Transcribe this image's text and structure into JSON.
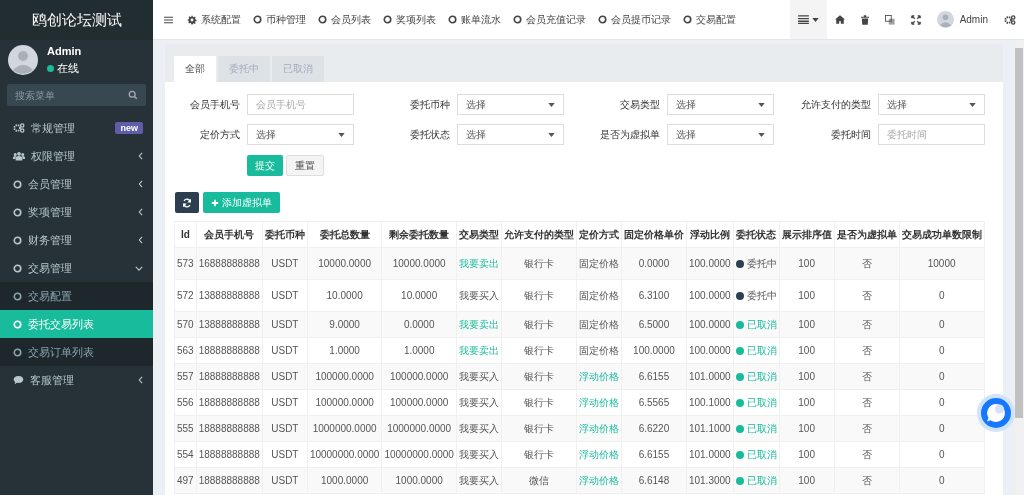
{
  "sidebar": {
    "title": "鸥创论坛测试",
    "user": {
      "name": "Admin",
      "status": "在线",
      "online": true
    },
    "search": {
      "placeholder": "搜索菜单"
    },
    "items": [
      {
        "label": "常规管理",
        "badge": "new"
      },
      {
        "label": "权限管理",
        "expanded": false
      },
      {
        "label": "会员管理",
        "expanded": false
      },
      {
        "label": "奖项管理",
        "expanded": false
      },
      {
        "label": "财务管理",
        "expanded": false
      },
      {
        "label": "交易管理",
        "expanded": true,
        "children": [
          {
            "label": "交易配置",
            "selected": false
          },
          {
            "label": "委托交易列表",
            "selected": true
          },
          {
            "label": "交易订单列表",
            "selected": false
          }
        ]
      },
      {
        "label": "客服管理",
        "expanded": false
      }
    ]
  },
  "topbar": {
    "tabs": [
      "系统配置",
      "币种管理",
      "会员列表",
      "奖项列表",
      "账单流水",
      "会员充值记录",
      "会员提币记录",
      "交易配置"
    ],
    "user": "Admin"
  },
  "tabs": [
    {
      "label": "全部",
      "selected": true
    },
    {
      "label": "委托中",
      "selected": false
    },
    {
      "label": "已取消",
      "selected": false
    }
  ],
  "filters": [
    {
      "label": "会员手机号",
      "kind": "input",
      "placeholder": "会员手机号"
    },
    {
      "label": "委托币种",
      "kind": "select",
      "value": "选择"
    },
    {
      "label": "交易类型",
      "kind": "select",
      "value": "选择"
    },
    {
      "label": "允许支付的类型",
      "kind": "select",
      "value": "选择"
    },
    {
      "label": "定价方式",
      "kind": "select",
      "value": "选择"
    },
    {
      "label": "委托状态",
      "kind": "select",
      "value": "选择"
    },
    {
      "label": "是否为虚拟单",
      "kind": "select",
      "value": "选择"
    },
    {
      "label": "委托时间",
      "kind": "input",
      "placeholder": "委托时间"
    }
  ],
  "form_buttons": [
    "提交",
    "重置"
  ],
  "toolbar": {
    "add_button": "添加虚拟单"
  },
  "table": {
    "columns": [
      "Id",
      "会员手机号",
      "委托币种",
      "委托总数量",
      "剩余委托数量",
      "交易类型",
      "允许支付的类型",
      "定价方式",
      "固定价格单价",
      "浮动比例",
      "委托状态",
      "展示排序值",
      "是否为虚拟单",
      "交易成功单数限制"
    ],
    "rows": [
      {
        "id": "573",
        "phone": "16888888888",
        "currency": "USDT",
        "total": "10000.0000",
        "remaining": "10000.0000",
        "trade_type": {
          "text": "我要卖出",
          "kind": "sell"
        },
        "pay_type": "银行卡",
        "pricing": {
          "text": "固定价格",
          "kind": "fixed"
        },
        "price": "0.0000",
        "ratio": "100.0000",
        "status": {
          "text": "委托中",
          "kind": "active"
        },
        "sort": "100",
        "virtual": "否",
        "limit": "10000"
      },
      {
        "id": "572",
        "phone": "13888888888",
        "currency": "USDT",
        "total": "10.0000",
        "remaining": "10.0000",
        "trade_type": {
          "text": "我要买入",
          "kind": "buy"
        },
        "pay_type": "银行卡",
        "pricing": {
          "text": "固定价格",
          "kind": "fixed"
        },
        "price": "6.3100",
        "ratio": "100.0000",
        "status": {
          "text": "委托中",
          "kind": "active"
        },
        "sort": "100",
        "virtual": "否",
        "limit": "0"
      },
      {
        "id": "570",
        "phone": "13888888888",
        "currency": "USDT",
        "total": "9.0000",
        "remaining": "0.0000",
        "trade_type": {
          "text": "我要卖出",
          "kind": "sell"
        },
        "pay_type": "银行卡",
        "pricing": {
          "text": "固定价格",
          "kind": "fixed"
        },
        "price": "6.5000",
        "ratio": "100.0000",
        "status": {
          "text": "已取消",
          "kind": "cancelled"
        },
        "sort": "100",
        "virtual": "否",
        "limit": "0"
      },
      {
        "id": "563",
        "phone": "18888888888",
        "currency": "USDT",
        "total": "1.0000",
        "remaining": "1.0000",
        "trade_type": {
          "text": "我要卖出",
          "kind": "sell"
        },
        "pay_type": "银行卡",
        "pricing": {
          "text": "固定价格",
          "kind": "fixed"
        },
        "price": "100.0000",
        "ratio": "100.0000",
        "status": {
          "text": "已取消",
          "kind": "cancelled"
        },
        "sort": "100",
        "virtual": "否",
        "limit": "0"
      },
      {
        "id": "557",
        "phone": "18888888888",
        "currency": "USDT",
        "total": "100000.0000",
        "remaining": "100000.0000",
        "trade_type": {
          "text": "我要买入",
          "kind": "buy"
        },
        "pay_type": "银行卡",
        "pricing": {
          "text": "浮动价格",
          "kind": "float"
        },
        "price": "6.6155",
        "ratio": "101.0000",
        "status": {
          "text": "已取消",
          "kind": "cancelled"
        },
        "sort": "100",
        "virtual": "否",
        "limit": "0"
      },
      {
        "id": "556",
        "phone": "18888888888",
        "currency": "USDT",
        "total": "100000.0000",
        "remaining": "100000.0000",
        "trade_type": {
          "text": "我要买入",
          "kind": "buy"
        },
        "pay_type": "银行卡",
        "pricing": {
          "text": "浮动价格",
          "kind": "float"
        },
        "price": "6.5565",
        "ratio": "100.1000",
        "status": {
          "text": "已取消",
          "kind": "cancelled"
        },
        "sort": "100",
        "virtual": "否",
        "limit": "0"
      },
      {
        "id": "555",
        "phone": "18888888888",
        "currency": "USDT",
        "total": "1000000.0000",
        "remaining": "1000000.0000",
        "trade_type": {
          "text": "我要买入",
          "kind": "buy"
        },
        "pay_type": "银行卡",
        "pricing": {
          "text": "浮动价格",
          "kind": "float"
        },
        "price": "6.6220",
        "ratio": "101.1000",
        "status": {
          "text": "已取消",
          "kind": "cancelled"
        },
        "sort": "100",
        "virtual": "否",
        "limit": "0"
      },
      {
        "id": "554",
        "phone": "18888888888",
        "currency": "USDT",
        "total": "10000000.0000",
        "remaining": "10000000.0000",
        "trade_type": {
          "text": "我要买入",
          "kind": "buy"
        },
        "pay_type": "银行卡",
        "pricing": {
          "text": "浮动价格",
          "kind": "float"
        },
        "price": "6.6155",
        "ratio": "101.0000",
        "status": {
          "text": "已取消",
          "kind": "cancelled"
        },
        "sort": "100",
        "virtual": "否",
        "limit": "0"
      },
      {
        "id": "497",
        "phone": "18888888888",
        "currency": "USDT",
        "total": "1000.0000",
        "remaining": "1000.0000",
        "trade_type": {
          "text": "我要买入",
          "kind": "buy"
        },
        "pay_type": "微信",
        "pricing": {
          "text": "浮动价格",
          "kind": "float"
        },
        "price": "6.6148",
        "ratio": "101.3000",
        "status": {
          "text": "已取消",
          "kind": "cancelled"
        },
        "sort": "100",
        "virtual": "否",
        "limit": "0"
      }
    ]
  }
}
